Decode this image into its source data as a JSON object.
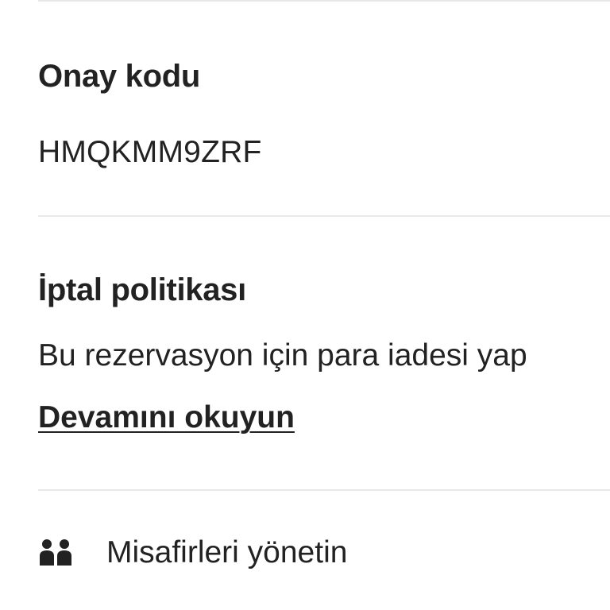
{
  "confirmation": {
    "title": "Onay kodu",
    "code": "HMQKMM9ZRF"
  },
  "cancellation": {
    "title": "İptal politikası",
    "description": "Bu rezervasyon için para iadesi yap",
    "read_more_label": "Devamını okuyun"
  },
  "actions": {
    "manage_guests_label": "Misafirleri yönetin",
    "manage_guests_icon": "guests-icon"
  }
}
